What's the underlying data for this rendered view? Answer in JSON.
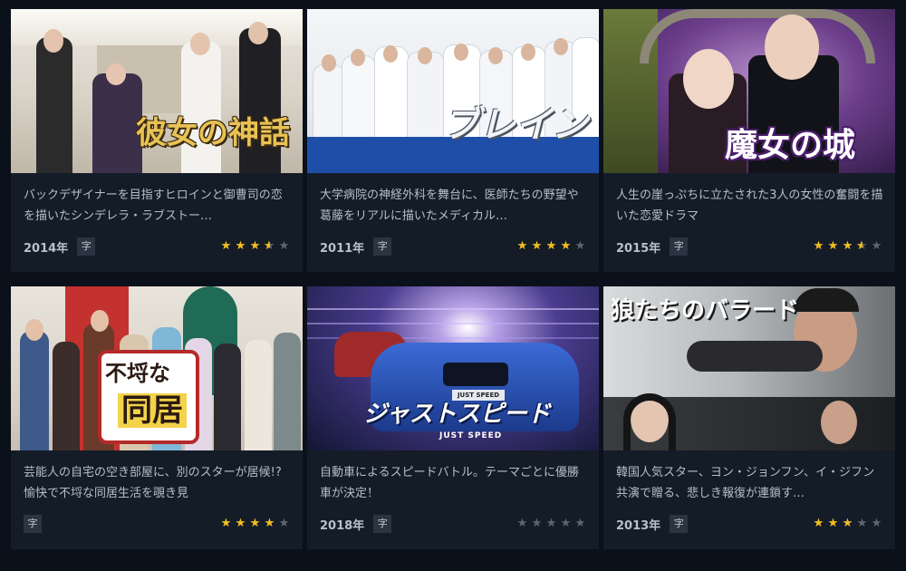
{
  "cards": [
    {
      "thumb_title": "彼女の神話",
      "description": "バックデザイナーを目指すヒロインと御曹司の恋を描いたシンデレラ・ラブストー…",
      "year": "2014年",
      "sub_badge": "字",
      "rating": 3.5
    },
    {
      "thumb_title": "ブレイン",
      "description": "大学病院の神経外科を舞台に、医師たちの野望や葛藤をリアルに描いたメディカル…",
      "year": "2011年",
      "sub_badge": "字",
      "rating": 4
    },
    {
      "thumb_title": "魔女の城",
      "description": "人生の崖っぷちに立たされた3人の女性の奮闘を描いた恋愛ドラマ",
      "year": "2015年",
      "sub_badge": "字",
      "rating": 3.5
    },
    {
      "thumb_title_line1": "不埒な",
      "thumb_title_line2": "同居",
      "description": "芸能人の自宅の空き部屋に、別のスターが居候!?愉快で不埒な同居生活を覗き見",
      "year": "",
      "sub_badge": "字",
      "rating": 4
    },
    {
      "thumb_title": "ジャストスピード",
      "thumb_subtitle": "JUST SPEED",
      "plate_text": "JUST SPEED",
      "description": "自動車によるスピードバトル。テーマごとに優勝車が決定！",
      "year": "2018年",
      "sub_badge": "字",
      "rating": 0
    },
    {
      "thumb_title": "狼たちのバラード",
      "description": "韓国人気スター、ヨン・ジョンフン、イ・ジフン共演で贈る、悲しき報復が連鎖す…",
      "year": "2013年",
      "sub_badge": "字",
      "rating": 3
    }
  ],
  "colors": {
    "background": "#0b111a",
    "card": "#141c28",
    "star_filled": "#f4bd1c",
    "star_empty": "#5f6672"
  }
}
